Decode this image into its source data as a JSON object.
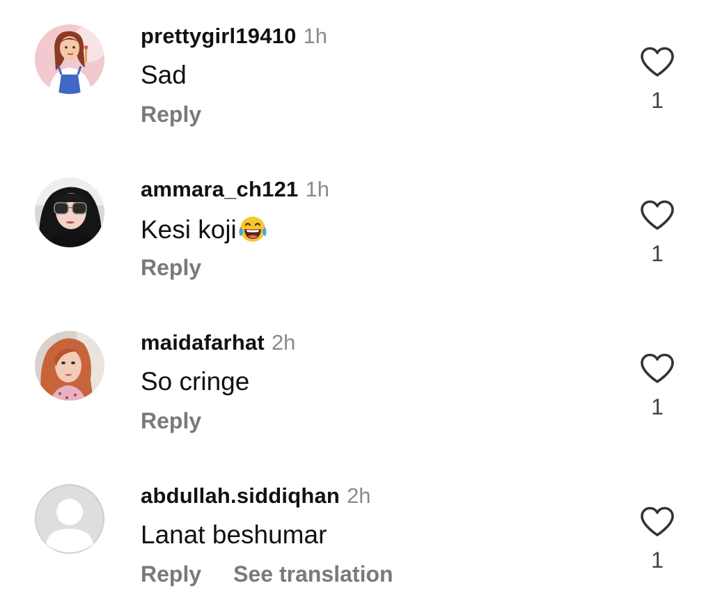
{
  "comments": [
    {
      "username": "prettygirl19410",
      "time": "1h",
      "text": "Sad",
      "emoji": "",
      "reply_label": "Reply",
      "translation_label": "",
      "likes": "1",
      "avatar_icon": "cartoon-princess-avatar"
    },
    {
      "username": "ammara_ch121",
      "time": "1h",
      "text": "Kesi koji",
      "emoji": "face-with-tears-of-joy",
      "reply_label": "Reply",
      "translation_label": "",
      "likes": "1",
      "avatar_icon": "woman-sunglasses-avatar"
    },
    {
      "username": "maidafarhat",
      "time": "2h",
      "text": "So cringe",
      "emoji": "",
      "reply_label": "Reply",
      "translation_label": "",
      "likes": "1",
      "avatar_icon": "woman-red-hair-avatar"
    },
    {
      "username": "abdullah.siddiqhan",
      "time": "2h",
      "text": "Lanat beshumar",
      "emoji": "",
      "reply_label": "Reply",
      "translation_label": "See translation",
      "likes": "1",
      "avatar_icon": "default-profile-avatar"
    }
  ],
  "colors": {
    "username": "#111111",
    "timestamp": "#8a8a8a",
    "reply": "#7a7a7a",
    "heart_outline": "#333333"
  }
}
